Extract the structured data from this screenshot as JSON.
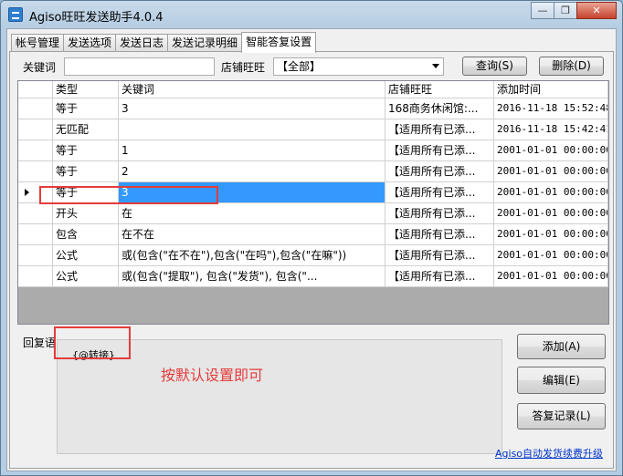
{
  "window": {
    "title": "Agiso旺旺发送助手4.0.4",
    "minimize_glyph": "—",
    "restore_glyph": "❐",
    "close_glyph": "✕"
  },
  "tabs": [
    {
      "label": "帐号管理"
    },
    {
      "label": "发送选项"
    },
    {
      "label": "发送日志"
    },
    {
      "label": "发送记录明细"
    },
    {
      "label": "智能答复设置",
      "active": true
    }
  ],
  "filter": {
    "keyword_label": "关键词",
    "keyword_value": "",
    "shop_label": "店铺旺旺",
    "shop_value": "【全部】",
    "query_button": "查询(S)",
    "delete_button": "删除(D)"
  },
  "grid": {
    "columns": [
      "类型",
      "关键词",
      "店铺旺旺",
      "添加时间"
    ],
    "rows": [
      {
        "type": "等于",
        "keyword": "3",
        "shop": "168商务休闲馆:...",
        "time": "2016-11-18 15:52:48"
      },
      {
        "type": "无匹配",
        "keyword": "",
        "shop": "【适用所有已添...",
        "time": "2016-11-18 15:42:41"
      },
      {
        "type": "等于",
        "keyword": "1",
        "shop": "【适用所有已添...",
        "time": "2001-01-01 00:00:00"
      },
      {
        "type": "等于",
        "keyword": "2",
        "shop": "【适用所有已添...",
        "time": "2001-01-01 00:00:00"
      },
      {
        "type": "等于",
        "keyword": "3",
        "shop": "【适用所有已添...",
        "time": "2001-01-01 00:00:00",
        "selected": true
      },
      {
        "type": "开头",
        "keyword": "在",
        "shop": "【适用所有已添...",
        "time": "2001-01-01 00:00:00"
      },
      {
        "type": "包含",
        "keyword": "在不在",
        "shop": "【适用所有已添...",
        "time": "2001-01-01 00:00:00"
      },
      {
        "type": "公式",
        "keyword": "或(包含(\"在不在\"),包含(\"在吗\"),包含(\"在嘛\"))",
        "shop": "【适用所有已添...",
        "time": "2001-01-01 00:00:00"
      },
      {
        "type": "公式",
        "keyword": "或(包含(\"提取\"), 包含(\"发货\"), 包含(\"...",
        "shop": "【适用所有已添...",
        "time": "2001-01-01 00:00:00"
      }
    ]
  },
  "reply": {
    "label": "回复语",
    "value": "{@转接}",
    "note": "按默认设置即可"
  },
  "actions": {
    "add_button": "添加(A)",
    "edit_button": "编辑(E)",
    "record_button": "答复记录(L)"
  },
  "footer": {
    "upgrade_link": "Agiso自动发货续费升级"
  },
  "colors": {
    "accent": "#3399ff",
    "annotation": "#e53b3b",
    "link": "#0033cc"
  }
}
